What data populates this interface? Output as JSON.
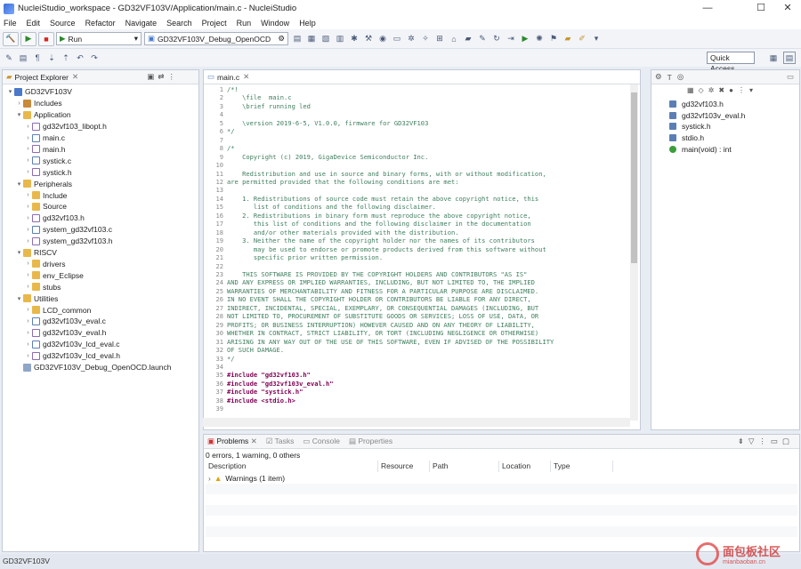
{
  "window": {
    "title": "NucleiStudio_workspace - GD32VF103V/Application/main.c - NucleiStudio",
    "controls": [
      "—",
      "☐",
      "✕"
    ]
  },
  "menu": [
    "File",
    "Edit",
    "Source",
    "Refactor",
    "Navigate",
    "Search",
    "Project",
    "Run",
    "Window",
    "Help"
  ],
  "toolbar": {
    "run_mode": "Run",
    "launch_config": "GD32VF103V_Debug_OpenOCD",
    "quick_access": "Quick Access"
  },
  "explorer": {
    "tab_label": "Project Explorer",
    "tree": [
      {
        "label": "GD32VF103V",
        "depth": 0,
        "icon": "proj",
        "expanded": true
      },
      {
        "label": "Includes",
        "depth": 1,
        "icon": "inc",
        "expanded": false
      },
      {
        "label": "Application",
        "depth": 1,
        "icon": "folder",
        "expanded": true
      },
      {
        "label": "gd32vf103_libopt.h",
        "depth": 2,
        "icon": "file-h",
        "expanded": false
      },
      {
        "label": "main.c",
        "depth": 2,
        "icon": "file-c",
        "expanded": false
      },
      {
        "label": "main.h",
        "depth": 2,
        "icon": "file-h",
        "expanded": false
      },
      {
        "label": "systick.c",
        "depth": 2,
        "icon": "file-c",
        "expanded": false
      },
      {
        "label": "systick.h",
        "depth": 2,
        "icon": "file-h",
        "expanded": false
      },
      {
        "label": "Peripherals",
        "depth": 1,
        "icon": "folder",
        "expanded": true
      },
      {
        "label": "Include",
        "depth": 2,
        "icon": "folder",
        "expanded": false
      },
      {
        "label": "Source",
        "depth": 2,
        "icon": "folder",
        "expanded": false
      },
      {
        "label": "gd32vf103.h",
        "depth": 2,
        "icon": "file-h",
        "expanded": false
      },
      {
        "label": "system_gd32vf103.c",
        "depth": 2,
        "icon": "file-c",
        "expanded": false
      },
      {
        "label": "system_gd32vf103.h",
        "depth": 2,
        "icon": "file-h",
        "expanded": false
      },
      {
        "label": "RISCV",
        "depth": 1,
        "icon": "folder",
        "expanded": true
      },
      {
        "label": "drivers",
        "depth": 2,
        "icon": "folder",
        "expanded": false
      },
      {
        "label": "env_Eclipse",
        "depth": 2,
        "icon": "folder",
        "expanded": false
      },
      {
        "label": "stubs",
        "depth": 2,
        "icon": "folder",
        "expanded": false
      },
      {
        "label": "Utilities",
        "depth": 1,
        "icon": "folder",
        "expanded": true
      },
      {
        "label": "LCD_common",
        "depth": 2,
        "icon": "folder",
        "expanded": false
      },
      {
        "label": "gd32vf103v_eval.c",
        "depth": 2,
        "icon": "file-c",
        "expanded": false
      },
      {
        "label": "gd32vf103v_eval.h",
        "depth": 2,
        "icon": "file-h",
        "expanded": false
      },
      {
        "label": "gd32vf103v_lcd_eval.c",
        "depth": 2,
        "icon": "file-c",
        "expanded": false
      },
      {
        "label": "gd32vf103v_lcd_eval.h",
        "depth": 2,
        "icon": "file-h",
        "expanded": false
      },
      {
        "label": "GD32VF103V_Debug_OpenOCD.launch",
        "depth": 1,
        "icon": "launch",
        "expanded": null
      }
    ]
  },
  "editor": {
    "tab_label": "main.c",
    "lines": [
      {
        "n": "1",
        "text": "/*!",
        "cls": "cm"
      },
      {
        "n": "2",
        "text": "    \\file  main.c",
        "cls": "cm"
      },
      {
        "n": "3",
        "text": "    \\brief running led",
        "cls": "cm"
      },
      {
        "n": "4",
        "text": "",
        "cls": "cm"
      },
      {
        "n": "5",
        "text": "    \\version 2019-6-5, V1.0.0, firmware for GD32VF103",
        "cls": "cm"
      },
      {
        "n": "6",
        "text": "*/",
        "cls": "cm"
      },
      {
        "n": "7",
        "text": "",
        "cls": ""
      },
      {
        "n": "8",
        "text": "/*",
        "cls": "cm"
      },
      {
        "n": "9",
        "text": "    Copyright (c) 2019, GigaDevice Semiconductor Inc.",
        "cls": "cm"
      },
      {
        "n": "10",
        "text": "",
        "cls": "cm"
      },
      {
        "n": "11",
        "text": "    Redistribution and use in source and binary forms, with or without modification,",
        "cls": "cm"
      },
      {
        "n": "12",
        "text": "are permitted provided that the following conditions are met:",
        "cls": "cm"
      },
      {
        "n": "13",
        "text": "",
        "cls": "cm"
      },
      {
        "n": "14",
        "text": "    1. Redistributions of source code must retain the above copyright notice, this",
        "cls": "cm"
      },
      {
        "n": "15",
        "text": "       list of conditions and the following disclaimer.",
        "cls": "cm"
      },
      {
        "n": "16",
        "text": "    2. Redistributions in binary form must reproduce the above copyright notice,",
        "cls": "cm"
      },
      {
        "n": "17",
        "text": "       this list of conditions and the following disclaimer in the documentation",
        "cls": "cm"
      },
      {
        "n": "18",
        "text": "       and/or other materials provided with the distribution.",
        "cls": "cm"
      },
      {
        "n": "19",
        "text": "    3. Neither the name of the copyright holder nor the names of its contributors",
        "cls": "cm"
      },
      {
        "n": "20",
        "text": "       may be used to endorse or promote products derived from this software without",
        "cls": "cm"
      },
      {
        "n": "21",
        "text": "       specific prior written permission.",
        "cls": "cm"
      },
      {
        "n": "22",
        "text": "",
        "cls": "cm"
      },
      {
        "n": "23",
        "text": "    THIS SOFTWARE IS PROVIDED BY THE COPYRIGHT HOLDERS AND CONTRIBUTORS \"AS IS\"",
        "cls": "cm"
      },
      {
        "n": "24",
        "text": "AND ANY EXPRESS OR IMPLIED WARRANTIES, INCLUDING, BUT NOT LIMITED TO, THE IMPLIED",
        "cls": "cm"
      },
      {
        "n": "25",
        "text": "WARRANTIES OF MERCHANTABILITY AND FITNESS FOR A PARTICULAR PURPOSE ARE DISCLAIMED.",
        "cls": "cm"
      },
      {
        "n": "26",
        "text": "IN NO EVENT SHALL THE COPYRIGHT HOLDER OR CONTRIBUTORS BE LIABLE FOR ANY DIRECT,",
        "cls": "cm"
      },
      {
        "n": "27",
        "text": "INDIRECT, INCIDENTAL, SPECIAL, EXEMPLARY, OR CONSEQUENTIAL DAMAGES (INCLUDING, BUT",
        "cls": "cm"
      },
      {
        "n": "28",
        "text": "NOT LIMITED TO, PROCUREMENT OF SUBSTITUTE GOODS OR SERVICES; LOSS OF USE, DATA, OR",
        "cls": "cm"
      },
      {
        "n": "29",
        "text": "PROFITS; OR BUSINESS INTERRUPTION) HOWEVER CAUSED AND ON ANY THEORY OF LIABILITY,",
        "cls": "cm"
      },
      {
        "n": "30",
        "text": "WHETHER IN CONTRACT, STRICT LIABILITY, OR TORT (INCLUDING NEGLIGENCE OR OTHERWISE)",
        "cls": "cm"
      },
      {
        "n": "31",
        "text": "ARISING IN ANY WAY OUT OF THE USE OF THIS SOFTWARE, EVEN IF ADVISED OF THE POSSIBILITY",
        "cls": "cm"
      },
      {
        "n": "32",
        "text": "OF SUCH DAMAGE.",
        "cls": "cm"
      },
      {
        "n": "33",
        "text": "*/",
        "cls": "cm"
      },
      {
        "n": "34",
        "text": "",
        "cls": ""
      },
      {
        "n": "35",
        "text": "#include \"gd32vf103.h\"",
        "cls": "inc"
      },
      {
        "n": "36",
        "text": "#include \"gd32vf103v_eval.h\"",
        "cls": "inc"
      },
      {
        "n": "37",
        "text": "#include \"systick.h\"",
        "cls": "inc"
      },
      {
        "n": "38",
        "text": "#include <stdio.h>",
        "cls": "inc"
      },
      {
        "n": "39",
        "text": "",
        "cls": ""
      }
    ]
  },
  "outline": {
    "items": [
      {
        "label": "gd32vf103.h",
        "icon": "file-h"
      },
      {
        "label": "gd32vf103v_eval.h",
        "icon": "file-h"
      },
      {
        "label": "systick.h",
        "icon": "file-h"
      },
      {
        "label": "stdio.h",
        "icon": "file-h"
      },
      {
        "label": "main(void) : int",
        "icon": "func"
      }
    ]
  },
  "bottom": {
    "tabs": [
      "Problems",
      "Tasks",
      "Console",
      "Properties"
    ],
    "summary": "0 errors, 1 warning, 0 others",
    "columns": [
      "Description",
      "Resource",
      "Path",
      "Location",
      "Type"
    ],
    "rows": [
      {
        "description": "Warnings (1 item)"
      }
    ]
  },
  "status": {
    "text": "GD32VF103V"
  },
  "watermark": {
    "text": "面包板社区",
    "url": "mianbaoban.cn"
  }
}
